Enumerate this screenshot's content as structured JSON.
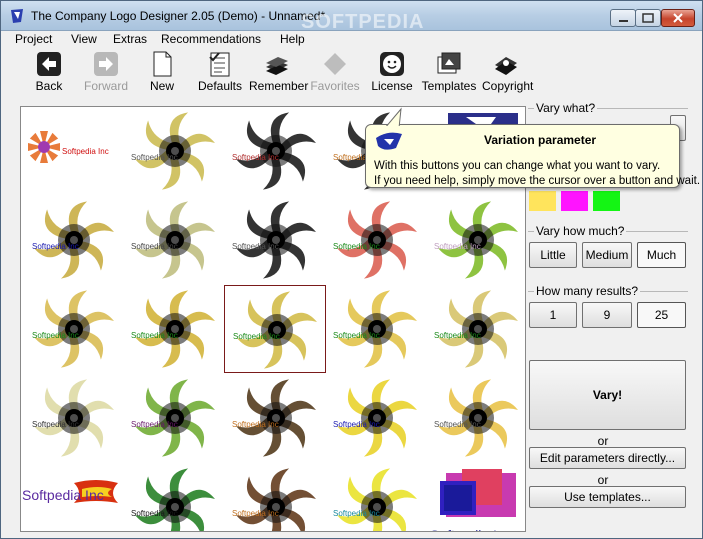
{
  "window": {
    "title": "The Company Logo Designer 2.05 (Demo) - Unnamed*",
    "watermark": "SOFTPEDIA"
  },
  "menubar": [
    "Project",
    "View",
    "Extras",
    "Recommendations",
    "Help"
  ],
  "toolbar": [
    {
      "label": "Back",
      "icon": "arrow-left-icon",
      "enabled": true
    },
    {
      "label": "Forward",
      "icon": "arrow-right-icon",
      "enabled": false
    },
    {
      "label": "New",
      "icon": "page-icon",
      "enabled": true
    },
    {
      "label": "Defaults",
      "icon": "checklist-icon",
      "enabled": true
    },
    {
      "label": "Remember",
      "icon": "books-icon",
      "enabled": true
    },
    {
      "label": "Favorites",
      "icon": "diamond-icon",
      "enabled": false
    },
    {
      "label": "License",
      "icon": "smiley-icon",
      "enabled": true
    },
    {
      "label": "Templates",
      "icon": "templates-icon",
      "enabled": true
    },
    {
      "label": "Copyright",
      "icon": "book-seal-icon",
      "enabled": true
    }
  ],
  "gallery": {
    "caption": "Softpedia Inc",
    "big_caption": "Softpedia Inc",
    "cells": [
      {
        "kind": "star",
        "color": "#e87b3a",
        "text": "#d01010"
      },
      {
        "kind": "swirl",
        "color": "#c9b84a",
        "text": "#555"
      },
      {
        "kind": "swirl",
        "color": "#111",
        "text": "#b03030"
      },
      {
        "kind": "swirl",
        "color": "#111",
        "text": "#c07020"
      },
      {
        "kind": "blue",
        "color": "#2b2f8a",
        "text": "#b07ab0"
      },
      {
        "kind": "swirl",
        "color": "#c6a93a",
        "text": "#1a1ab0"
      },
      {
        "kind": "swirl",
        "color": "#bcbb7a",
        "text": "#444"
      },
      {
        "kind": "swirl",
        "color": "#111",
        "text": "#555"
      },
      {
        "kind": "swirl",
        "color": "#d9584a",
        "text": "#1a8a1a"
      },
      {
        "kind": "swirl",
        "color": "#7ab820",
        "text": "#c0a0c0"
      },
      {
        "kind": "swirl",
        "color": "#d7b94a",
        "text": "#1a8a1a"
      },
      {
        "kind": "swirl",
        "color": "#d0b030",
        "text": "#1a8a1a"
      },
      {
        "kind": "swirl",
        "color": "#d0b840",
        "text": "#1a8a1a"
      },
      {
        "kind": "swirl",
        "color": "#e0c040",
        "text": "#1a8a1a"
      },
      {
        "kind": "swirl",
        "color": "#d4c060",
        "text": "#1a8a1a"
      },
      {
        "kind": "swirl",
        "color": "#dcd8a0",
        "text": "#333"
      },
      {
        "kind": "swirl",
        "color": "#6aa82a",
        "text": "#6a1a6a"
      },
      {
        "kind": "swirl",
        "color": "#4a3010",
        "text": "#c07020"
      },
      {
        "kind": "swirl",
        "color": "#e8d020",
        "text": "#1a1ab0"
      },
      {
        "kind": "swirl",
        "color": "#e8c040",
        "text": "#555"
      },
      {
        "kind": "flag",
        "color": "#d83010",
        "text": "#5a2aa0"
      },
      {
        "kind": "swirl",
        "color": "#1a7a1a",
        "text": "#1a1a1a"
      },
      {
        "kind": "swirl",
        "color": "#5a3010",
        "text": "#c07020"
      },
      {
        "kind": "swirl",
        "color": "#e8e020",
        "text": "#1a8aa0"
      },
      {
        "kind": "boxes",
        "color": "#3020c0",
        "text": "#3a3aa0"
      }
    ]
  },
  "panel": {
    "vary_what_label": "Vary what?",
    "swatches": [
      "#ffe45c",
      "#ff14ff",
      "#14f514"
    ],
    "vary_how_label": "Vary how much?",
    "how_buttons": [
      "Little",
      "Medium",
      "Much"
    ],
    "how_selected": "Much",
    "results_label": "How many results?",
    "result_buttons": [
      "1",
      "9",
      "25"
    ],
    "results_selected": "25",
    "vary_button": "Vary!",
    "or1": "or",
    "edit_button": "Edit parameters directly...",
    "or2": "or",
    "templates_button": "Use templates..."
  },
  "tooltip": {
    "title": "Variation parameter",
    "line1": "With this buttons you can change what you want to vary.",
    "line2": "If you need help, simply move the cursor over a button and wait."
  }
}
